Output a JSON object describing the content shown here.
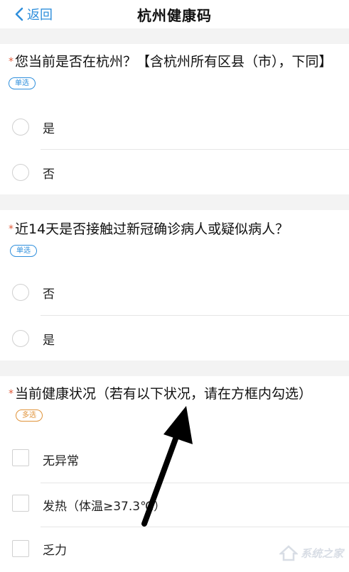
{
  "nav": {
    "back_label": "返回",
    "title": "杭州健康码"
  },
  "questions": [
    {
      "required_mark": "*",
      "text": "您当前是否在杭州？【含杭州所有区县（市），下同】",
      "tag": "单选",
      "options": [
        "是",
        "否"
      ]
    },
    {
      "required_mark": "*",
      "text": "近14天是否接触过新冠确诊病人或疑似病人？",
      "tag": "单选",
      "options": [
        "否",
        "是"
      ]
    },
    {
      "required_mark": "*",
      "text": "当前健康状况（若有以下状况，请在方框内勾选）",
      "tag": "多选",
      "options": [
        "无异常",
        "发热（体温≥37.3℃）",
        "乏力"
      ]
    }
  ],
  "watermark": {
    "text": "系统之家"
  },
  "colors": {
    "accent": "#2f8fdc",
    "required": "#e05a3a",
    "multi_tag": "#e0933a",
    "annotation_arrow": "#000000"
  },
  "icons": {
    "back": "chevron-left-icon",
    "option_single": "radio-circle-icon",
    "option_multi": "checkbox-square-icon",
    "annotation": "arrow-annotation-icon",
    "watermark_logo": "watermark-logo-icon"
  }
}
